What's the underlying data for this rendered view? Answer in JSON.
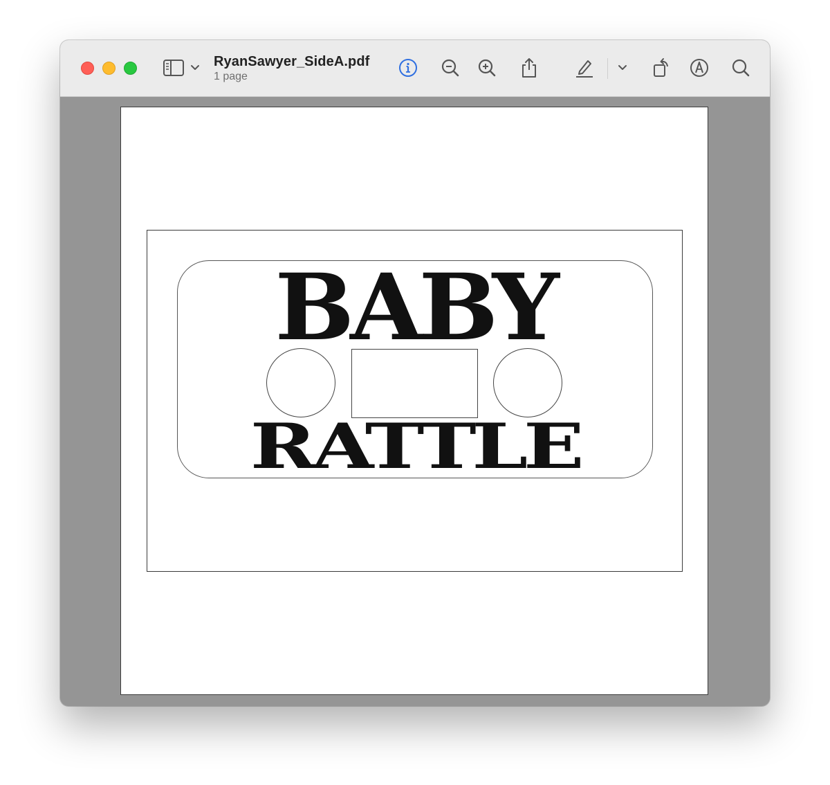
{
  "window": {
    "title": "RyanSawyer_SideA.pdf",
    "subtitle": "1 page",
    "traffic_colors": {
      "close": "#ff5f57",
      "minimize": "#febc2e",
      "maximize": "#28c840"
    }
  },
  "toolbar": {
    "icons": [
      "sidebar-icon",
      "chevron-down-icon",
      "info-icon",
      "zoom-out-icon",
      "zoom-in-icon",
      "share-icon",
      "markup-pen-icon",
      "chevron-down-icon",
      "rotate-icon",
      "annotate-icon",
      "search-icon"
    ],
    "accent_color": "#2f6fe0"
  },
  "document": {
    "cassette": {
      "top_word": "BABY",
      "bottom_word": "RATTLE"
    }
  }
}
